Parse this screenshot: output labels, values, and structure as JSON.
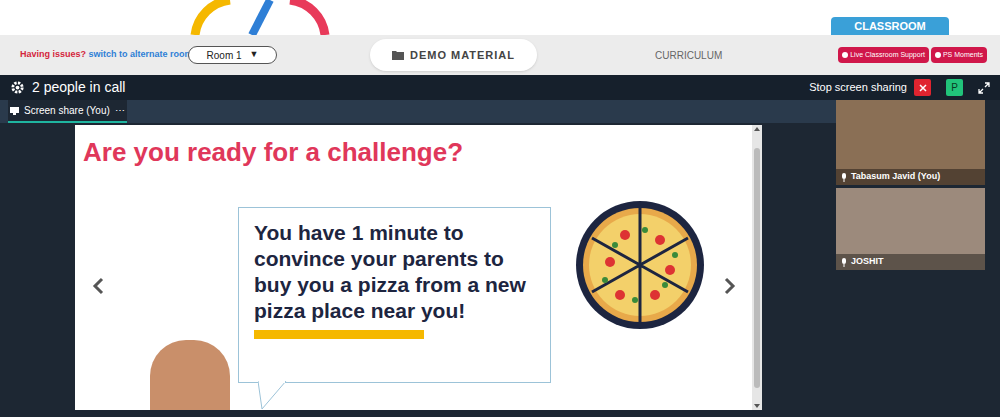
{
  "header": {
    "issue_label": "Having issues?",
    "switch_link": "switch to alternate room",
    "room": "Room 1",
    "room_caret": "▼",
    "demo_material": "DEMO MATERIAL",
    "curriculum": "CURRICULUM",
    "classroom": "CLASSROOM",
    "buttons": [
      "Live Classroom Support",
      "PS Moments"
    ]
  },
  "call_bar": {
    "people": "2 people in call",
    "stop_sharing": "Stop screen sharing",
    "avatar": "P"
  },
  "tabs": [
    {
      "label": "Screen share (You)",
      "selected": true,
      "menu": "⋯"
    }
  ],
  "slide": {
    "title": "Are you ready for a challenge?",
    "prompt": "You have 1 minute to convince your parents to buy you a pizza from a new pizza place near you!"
  },
  "participants": [
    {
      "name": "Tabasum Javid (You)"
    },
    {
      "name": "JOSHIT"
    }
  ]
}
